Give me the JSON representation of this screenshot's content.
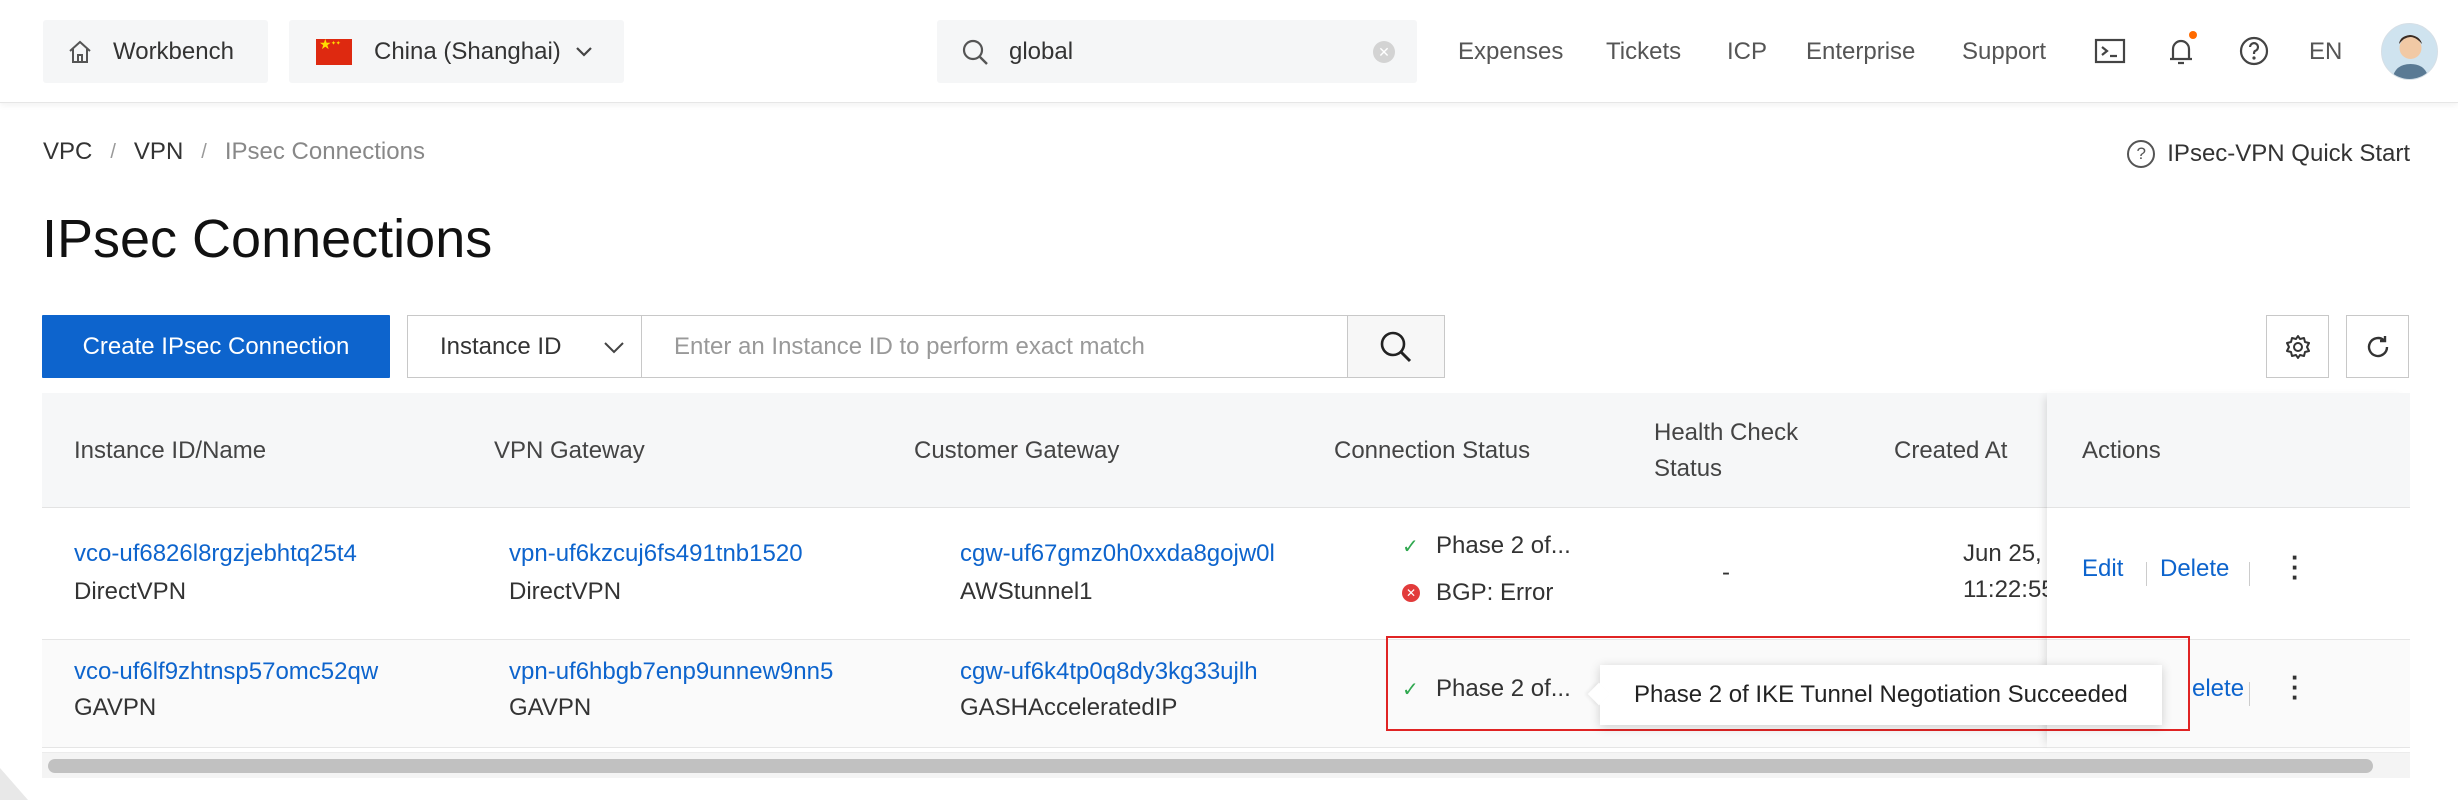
{
  "topbar": {
    "workbench_label": "Workbench",
    "region_label": "China (Shanghai)",
    "search_value": "global",
    "links": [
      "Expenses",
      "Tickets",
      "ICP",
      "Enterprise",
      "Support"
    ],
    "language": "EN"
  },
  "breadcrumb": {
    "items": [
      "VPC",
      "VPN",
      "IPsec Connections"
    ]
  },
  "quickstart_label": "IPsec-VPN Quick Start",
  "page_title": "IPsec Connections",
  "toolbar": {
    "create_label": "Create IPsec Connection",
    "filter_select": "Instance ID",
    "filter_placeholder": "Enter an Instance ID to perform exact match"
  },
  "table": {
    "headers": {
      "instance": "Instance ID/Name",
      "gateway": "VPN Gateway",
      "customer": "Customer Gateway",
      "status": "Connection Status",
      "health_line1": "Health Check",
      "health_line2": "Status",
      "created": "Created At",
      "actions": "Actions"
    },
    "rows": [
      {
        "instance_id": "vco-uf6826l8rgzjebhtq25t4",
        "instance_name": "DirectVPN",
        "gateway_id": "vpn-uf6kzcuj6fs491tnb1520",
        "gateway_name": "DirectVPN",
        "customer_id": "cgw-uf67gmz0h0xxda8gojw0l",
        "customer_name": "AWStunnel1",
        "status_phase": "Phase 2 of...",
        "status_bgp": "BGP: Error",
        "health": "-",
        "created_line1": "Jun 25,",
        "created_line2": "11:22:55",
        "edit": "Edit",
        "delete": "Delete"
      },
      {
        "instance_id": "vco-uf6lf9zhtnsp57omc52qw",
        "instance_name": "GAVPN",
        "gateway_id": "vpn-uf6hbgb7enp9unnew9nn5",
        "gateway_name": "GAVPN",
        "customer_id": "cgw-uf6k4tp0q8dy3kg33ujlh",
        "customer_name": "GASHAcceleratedIP",
        "status_phase": "Phase 2 of...",
        "delete": "elete"
      }
    ]
  },
  "tooltip_text": "Phase 2 of IKE Tunnel Negotiation Succeeded",
  "colors": {
    "primary": "#0d64cd",
    "success": "#2fa84f",
    "error": "#e23b3b",
    "highlight": "#e02424"
  }
}
